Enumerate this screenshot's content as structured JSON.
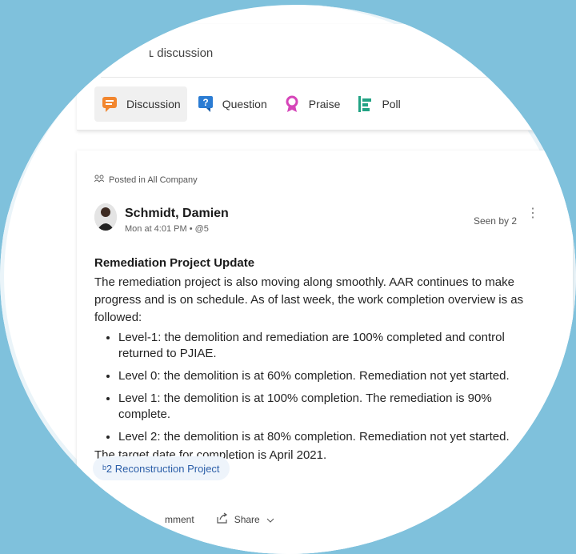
{
  "composer": {
    "placeholder": "ʟ discussion",
    "tabs": [
      {
        "label": "Discussion",
        "icon": "discussion-icon",
        "color": "#f2862e"
      },
      {
        "label": "Question",
        "icon": "question-icon",
        "color": "#2b7cd3"
      },
      {
        "label": "Praise",
        "icon": "praise-icon",
        "color": "#d645b9"
      },
      {
        "label": "Poll",
        "icon": "poll-icon",
        "color": "#22a384"
      }
    ]
  },
  "post": {
    "posted_in": "Posted in All Company",
    "author": "Schmidt, Damien",
    "meta": "Mon at 4:01 PM  •  @5",
    "seen_by": "Seen by 2",
    "more": "⋮",
    "title": "Remediation Project Update",
    "intro": "The remediation project is also moving along smoothly. AAR continues to make progress and is on schedule. As of last week, the work completion overview is as followed:",
    "bullets": [
      "Level-1: the demolition and remediation are 100% completed and control returned to PJIAE.",
      "Level 0: the demolition is at 60% completion. Remediation not yet started.",
      "Level 1: the demolition is at 100% completion. The remediation is 90% complete.",
      "Level 2: the demolition is at 80% completion. Remediation not yet started."
    ],
    "closing": "The target date for completion is April 2021.",
    "topic": "ᵇ2 Reconstruction Project",
    "actions": {
      "comment": "mment",
      "share": "Share"
    }
  }
}
